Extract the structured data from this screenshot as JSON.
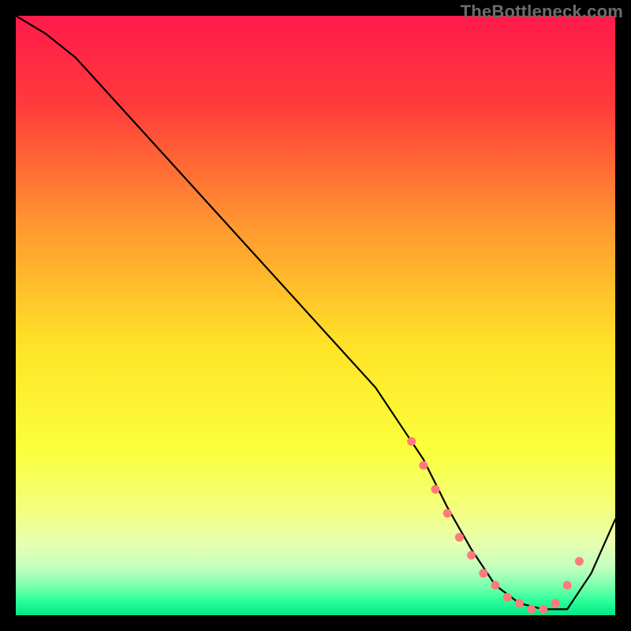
{
  "watermark": "TheBottleneck.com",
  "chart_data": {
    "type": "line",
    "title": "",
    "xlabel": "",
    "ylabel": "",
    "xlim": [
      0,
      100
    ],
    "ylim": [
      0,
      100
    ],
    "grid": false,
    "legend": false,
    "background_gradient_stops": [
      {
        "pos": 0.0,
        "color": "#ff1a4b"
      },
      {
        "pos": 0.15,
        "color": "#ff3b3b"
      },
      {
        "pos": 0.35,
        "color": "#ff9830"
      },
      {
        "pos": 0.55,
        "color": "#ffe327"
      },
      {
        "pos": 0.72,
        "color": "#fbff3a"
      },
      {
        "pos": 0.82,
        "color": "#f3ff7a"
      },
      {
        "pos": 0.88,
        "color": "#e7ffb0"
      },
      {
        "pos": 0.92,
        "color": "#c3ffbf"
      },
      {
        "pos": 0.95,
        "color": "#7effaf"
      },
      {
        "pos": 0.975,
        "color": "#2eff9a"
      },
      {
        "pos": 1.0,
        "color": "#00e886"
      }
    ],
    "series": [
      {
        "name": "bottleneck-curve",
        "color": "#000000",
        "x": [
          0,
          5,
          10,
          20,
          30,
          40,
          50,
          60,
          68,
          72,
          76,
          80,
          84,
          88,
          92,
          96,
          100
        ],
        "y": [
          100,
          97,
          93,
          82,
          71,
          60,
          49,
          38,
          26,
          18,
          11,
          5,
          2,
          1,
          1,
          7,
          16
        ]
      }
    ],
    "markers": {
      "name": "highlighted-range",
      "color": "#ff7a7a",
      "x": [
        66,
        68,
        70,
        72,
        74,
        76,
        78,
        80,
        82,
        84,
        86,
        88,
        90,
        92,
        94
      ],
      "y": [
        29,
        25,
        21,
        17,
        13,
        10,
        7,
        5,
        3,
        2,
        1,
        1,
        2,
        5,
        9
      ]
    }
  }
}
